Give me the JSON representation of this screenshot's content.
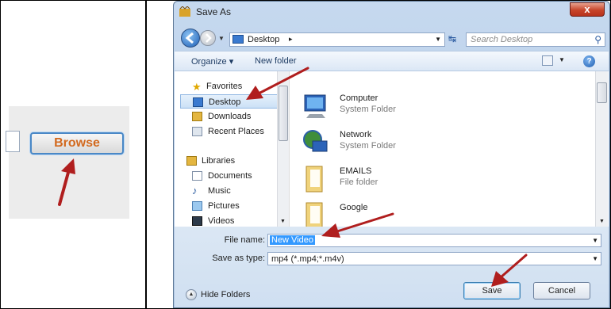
{
  "left_cell": {
    "browse_label": "Browse"
  },
  "dialog": {
    "title": "Save As",
    "close_label": "x",
    "address": {
      "location": "Desktop",
      "separator": "▸"
    },
    "search_placeholder": "Search Desktop",
    "toolbar": {
      "organize_label": "Organize ▾",
      "new_folder_label": "New folder",
      "help_label": "?"
    },
    "nav_pane": {
      "favorites_header": "Favorites",
      "favorites": [
        "Desktop",
        "Downloads",
        "Recent Places"
      ],
      "libraries_header": "Libraries",
      "libraries": [
        "Documents",
        "Music",
        "Pictures",
        "Videos"
      ],
      "selected": "Desktop"
    },
    "files": [
      {
        "name": "Computer",
        "type": "System Folder",
        "icon": "computer-icon"
      },
      {
        "name": "Network",
        "type": "System Folder",
        "icon": "network-icon"
      },
      {
        "name": "EMAILS",
        "type": "File folder",
        "icon": "folder-icon"
      },
      {
        "name": "Google",
        "type": "",
        "icon": "folder-icon"
      }
    ],
    "form": {
      "file_name_label": "File name:",
      "file_name_value": "New Video",
      "save_as_type_label": "Save as type:",
      "save_as_type_value": "mp4 (*.mp4;*.m4v)",
      "hide_folders_label": "Hide Folders",
      "save_label": "Save",
      "cancel_label": "Cancel"
    }
  },
  "colors": {
    "annotation_arrow": "#b01e1e",
    "selection": "#3399ff",
    "browse_text": "#d2691e"
  }
}
